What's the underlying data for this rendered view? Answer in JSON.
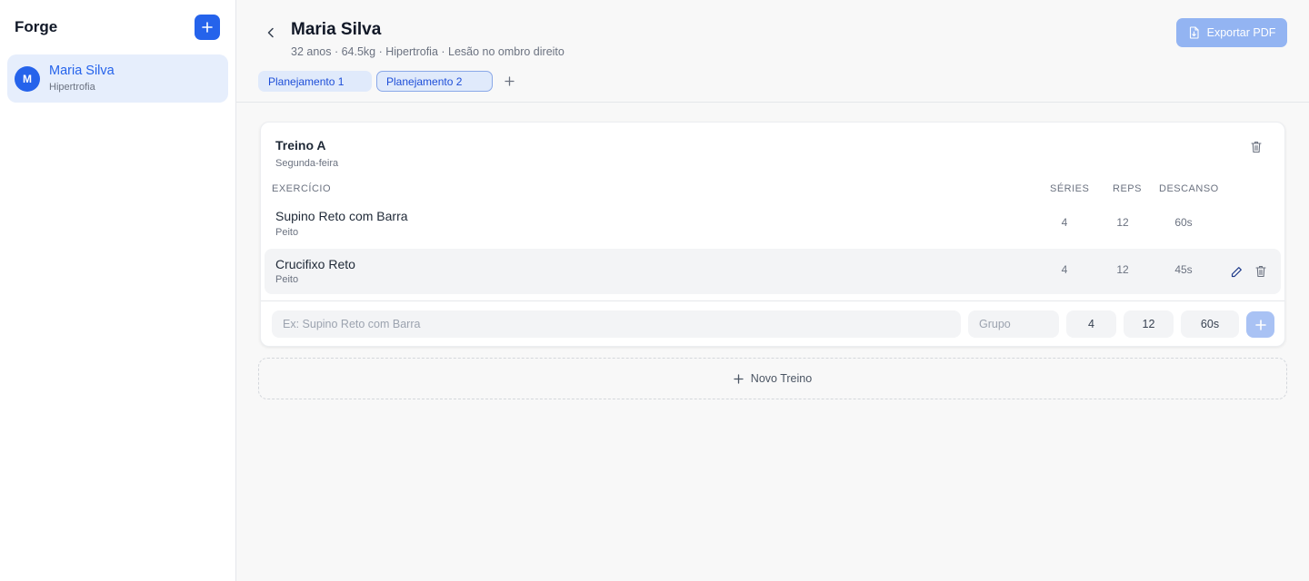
{
  "app": {
    "title": "Forge"
  },
  "sidebar": {
    "students": [
      {
        "initial": "M",
        "name": "Maria Silva",
        "goal": "Hipertrofia"
      }
    ]
  },
  "header": {
    "title": "Maria Silva",
    "meta": "32 anos · 64.5kg · Hipertrofia · Lesão no ombro direito",
    "export_label": "Exportar PDF"
  },
  "plans": {
    "tabs": [
      {
        "label": "Planejamento 1",
        "active": false
      },
      {
        "label": "Planejamento 2",
        "active": true
      }
    ]
  },
  "workout": {
    "title": "Treino A",
    "day": "Segunda-feira",
    "columns": {
      "exercise": "EXERCÍCIO",
      "series": "SÉRIES",
      "reps": "REPS",
      "rest": "DESCANSO"
    },
    "exercises": [
      {
        "name": "Supino Reto com Barra",
        "group": "Peito",
        "series": "4",
        "reps": "12",
        "rest": "60s"
      },
      {
        "name": "Crucifixo Reto",
        "group": "Peito",
        "series": "4",
        "reps": "12",
        "rest": "45s"
      }
    ],
    "new_exercise": {
      "name_placeholder": "Ex: Supino Reto com Barra",
      "group_placeholder": "Grupo",
      "series": "4",
      "reps": "12",
      "rest": "60s"
    }
  },
  "new_workout_label": "Novo Treino",
  "colors": {
    "accent": "#2563eb",
    "accent_light": "#e6eefc",
    "export_disabled": "#93b4f2"
  }
}
